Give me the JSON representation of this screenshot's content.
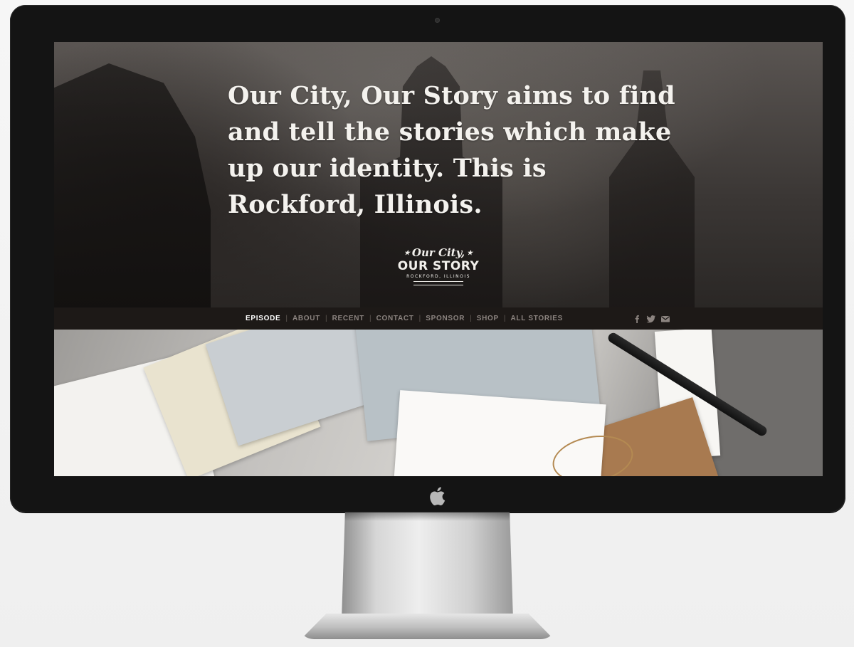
{
  "hero": {
    "headline": "Our City, Our Story aims to find and tell the stories which make up our identity. This is Rockford, Illinois."
  },
  "logo": {
    "script": "Our City,",
    "main": "OUR STORY",
    "sub": "ROCKFORD, ILLINOIS"
  },
  "nav": {
    "items": [
      {
        "label": "EPISODE",
        "active": true
      },
      {
        "label": "ABOUT",
        "active": false
      },
      {
        "label": "RECENT",
        "active": false
      },
      {
        "label": "CONTACT",
        "active": false
      },
      {
        "label": "SPONSOR",
        "active": false
      },
      {
        "label": "SHOP",
        "active": false
      },
      {
        "label": "ALL STORIES",
        "active": false
      }
    ],
    "separator": "|",
    "social": [
      "facebook-icon",
      "twitter-icon",
      "mail-icon"
    ]
  },
  "colors": {
    "nav_bg": "#1d1917",
    "nav_text": "#8c8480",
    "nav_active": "#ffffff",
    "hero_text": "#f4f2ee",
    "bezel": "#141414"
  }
}
